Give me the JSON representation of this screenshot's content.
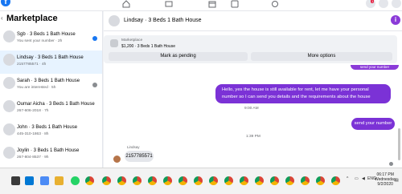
{
  "sidebar": {
    "title": "Marketplace",
    "conversations": [
      {
        "name": "Sgb · 3 Beds 1 Bath House",
        "sub": "You sent your number · 2h"
      },
      {
        "name": "Lindsay · 3 Beds 1 Bath House",
        "sub": "2157785571 · 4h"
      },
      {
        "name": "Sarah · 3 Beds 1 Bath House",
        "sub": "You are interested · 5h"
      },
      {
        "name": "Oumar Aicha · 3 Beds 1 Bath House",
        "sub": "267-606-2018 · 7h"
      },
      {
        "name": "John · 3 Beds 1 Bath House",
        "sub": "445-310-1863 · 8h"
      },
      {
        "name": "Joylin · 3 Beds 1 Bath House",
        "sub": "267-804-8537 · 9h"
      }
    ]
  },
  "chat": {
    "title": "Lindsay · 3 Beds 1 Bath House",
    "listing_label": "Marketplace",
    "listing_price": "$1,200 · 3 Beds 1 Bath House",
    "mark_pending": "Mark as pending",
    "more_options": "More options",
    "top_bubble": "send your number",
    "messages": {
      "out1": "Hello, yes the house is still available for rent, let me have your personal number so I can send you details and the requirements about the house",
      "time1": "9:00 AM",
      "out2": "send your number",
      "time2": "1:39 PM",
      "sender": "Lindsay",
      "in1": "2157785571"
    }
  },
  "nav": {
    "notification_count": "1"
  },
  "taskbar": {
    "time": "06:17 PM",
    "day": "Wednesday",
    "date": "9/2/2020",
    "lang": "ENG"
  },
  "colors": {
    "messenger_purple": "#7b32d6",
    "facebook_blue": "#1877f2"
  }
}
